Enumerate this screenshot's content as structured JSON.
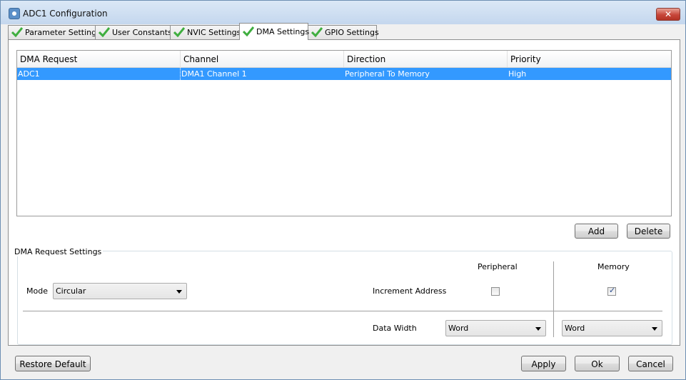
{
  "window": {
    "title": "ADC1 Configuration",
    "close_label": "✕"
  },
  "tabs": [
    {
      "label": "Parameter Settings"
    },
    {
      "label": "User Constants"
    },
    {
      "label": "NVIC Settings"
    },
    {
      "label": "DMA Settings",
      "active": true
    },
    {
      "label": "GPIO Settings"
    }
  ],
  "table": {
    "columns": [
      "DMA Request",
      "Channel",
      "Direction",
      "Priority"
    ],
    "rows": [
      {
        "request": "ADC1",
        "channel": "DMA1 Channel 1",
        "direction": "Peripheral To Memory",
        "priority": "High",
        "selected": true
      }
    ]
  },
  "actions": {
    "add_label": "Add",
    "delete_label": "Delete"
  },
  "settings": {
    "group_title": "DMA Request Settings",
    "mode_label": "Mode",
    "mode_value": "Circular",
    "peripheral_header": "Peripheral",
    "memory_header": "Memory",
    "increment_label": "Increment Address",
    "peripheral_increment": false,
    "memory_increment": true,
    "memory_check_glyph": "✓",
    "data_width_label": "Data Width",
    "peripheral_width": "Word",
    "memory_width": "Word"
  },
  "footer": {
    "restore_label": "Restore Default",
    "apply_label": "Apply",
    "ok_label": "Ok",
    "cancel_label": "Cancel"
  },
  "colors": {
    "selection": "#3399ff",
    "check_green": "#3fae3f"
  }
}
